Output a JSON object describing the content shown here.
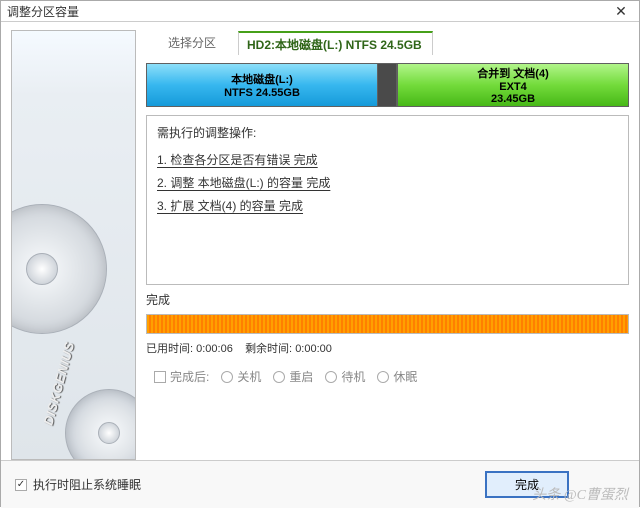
{
  "titlebar": {
    "title": "调整分区容量"
  },
  "tab": {
    "select": "选择分区",
    "active": "HD2:本地磁盘(L:) NTFS 24.5GB"
  },
  "partitions": [
    {
      "title": "本地磁盘(L:)",
      "sub": "NTFS 24.55GB"
    },
    {
      "title": "合并到 文档(4)",
      "sub1": "EXT4",
      "sub2": "23.45GB"
    }
  ],
  "steps": {
    "title": "需执行的调整操作:",
    "items": [
      "1. 检查各分区是否有错误    完成",
      "2. 调整 本地磁盘(L:) 的容量    完成",
      "3. 扩展 文档(4) 的容量    完成"
    ]
  },
  "doneLabel": "完成",
  "times": {
    "elapsed_label": "已用时间:",
    "elapsed": "0:00:06",
    "remain_label": "剩余时间:",
    "remain": "0:00:00"
  },
  "options": {
    "after": "完成后:",
    "shutdown": "关机",
    "reboot": "重启",
    "standby": "待机",
    "sleep": "休眠"
  },
  "footer": {
    "block_sleep": "执行时阻止系统睡眠",
    "finish_btn": "完成"
  },
  "brand": "DISKGENIUS",
  "watermark": "头条 @C曹蛋烈"
}
